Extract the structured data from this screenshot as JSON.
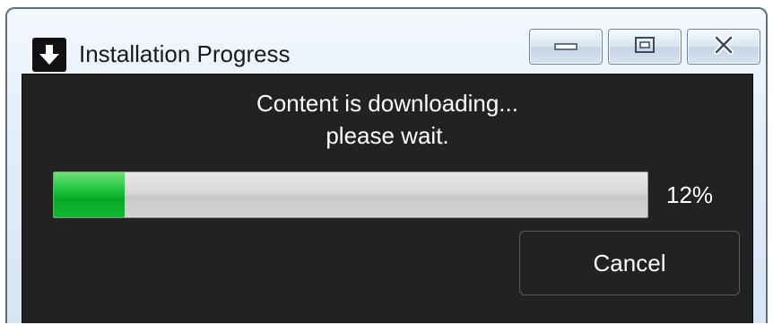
{
  "window": {
    "title": "Installation Progress",
    "icon": "download-arrow-icon"
  },
  "caption_buttons": {
    "minimize_icon": "minimize-icon",
    "restore_icon": "restore-icon",
    "close_icon": "close-icon"
  },
  "content": {
    "message_line_1": "Content is downloading...",
    "message_line_2": "please wait."
  },
  "progress": {
    "percent_value": 12,
    "percent_label": "12%",
    "fill_color": "#08a826"
  },
  "actions": {
    "cancel_label": "Cancel"
  }
}
